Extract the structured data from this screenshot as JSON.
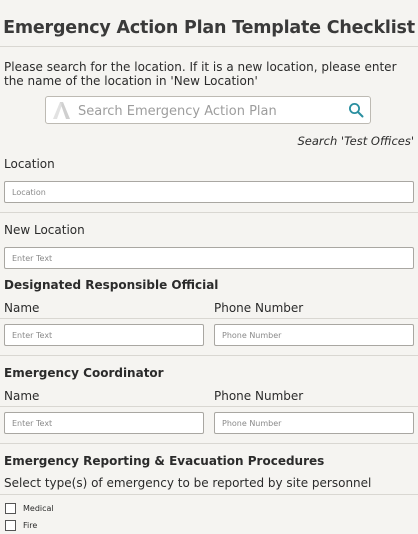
{
  "header": {
    "title": "Emergency Action Plan Template Checklist"
  },
  "intro": {
    "text": "Please search for the location. If it is a new location, please enter the name of the location in 'New Location'"
  },
  "search": {
    "placeholder": "Search Emergency Action Plan",
    "value": "",
    "hint": "Search 'Test Offices'"
  },
  "location": {
    "label": "Location",
    "placeholder": "Location"
  },
  "new_location": {
    "label": "New Location",
    "placeholder": "Enter Text"
  },
  "designated_official": {
    "heading": "Designated Responsible Official",
    "name_label": "Name",
    "name_placeholder": "Enter Text",
    "phone_label": "Phone Number",
    "phone_placeholder": "Phone Number"
  },
  "coordinator": {
    "heading": "Emergency Coordinator",
    "name_label": "Name",
    "name_placeholder": "Enter Text",
    "phone_label": "Phone Number",
    "phone_placeholder": "Phone Number"
  },
  "reporting": {
    "heading": "Emergency Reporting & Evacuation Procedures",
    "question": "Select type(s) of emergency to be reported by site personnel",
    "options": [
      {
        "label": "Medical",
        "checked": false
      },
      {
        "label": "Fire",
        "checked": false
      }
    ]
  },
  "colors": {
    "background": "#f5f4f1",
    "accent": "#2a8fa0",
    "logo": "#cfcfcf",
    "text": "#2b2b2b"
  },
  "icons": {
    "search_logo": "logo-icon",
    "search": "search-icon"
  }
}
